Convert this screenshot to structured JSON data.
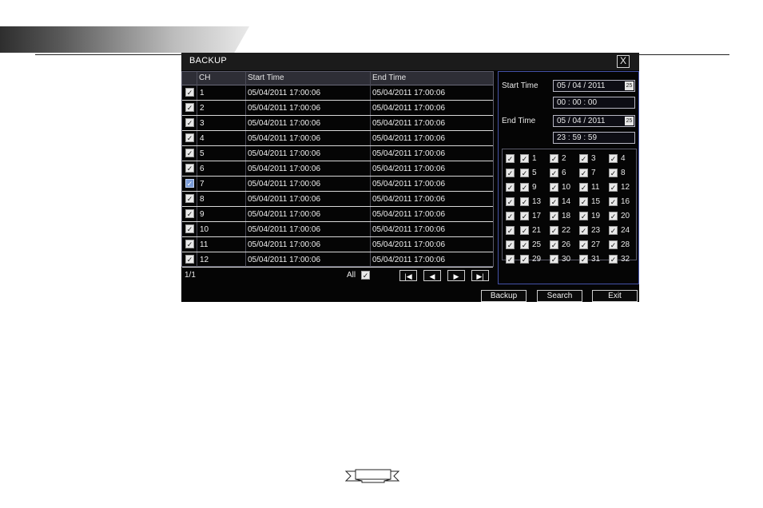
{
  "dialog": {
    "title": "BACKUP",
    "close_glyph": "X"
  },
  "table": {
    "headers": [
      "CH",
      "Start Time",
      "End Time"
    ],
    "rows": [
      {
        "ch": "1",
        "start": "05/04/2011 17:00:06",
        "end": "05/04/2011 17:00:06",
        "checked": true
      },
      {
        "ch": "2",
        "start": "05/04/2011 17:00:06",
        "end": "05/04/2011 17:00:06",
        "checked": true
      },
      {
        "ch": "3",
        "start": "05/04/2011 17:00:06",
        "end": "05/04/2011 17:00:06",
        "checked": true
      },
      {
        "ch": "4",
        "start": "05/04/2011 17:00:06",
        "end": "05/04/2011 17:00:06",
        "checked": true
      },
      {
        "ch": "5",
        "start": "05/04/2011 17:00:06",
        "end": "05/04/2011 17:00:06",
        "checked": true
      },
      {
        "ch": "6",
        "start": "05/04/2011 17:00:06",
        "end": "05/04/2011 17:00:06",
        "checked": true
      },
      {
        "ch": "7",
        "start": "05/04/2011 17:00:06",
        "end": "05/04/2011 17:00:06",
        "checked": true,
        "selected": true
      },
      {
        "ch": "8",
        "start": "05/04/2011 17:00:06",
        "end": "05/04/2011 17:00:06",
        "checked": true
      },
      {
        "ch": "9",
        "start": "05/04/2011 17:00:06",
        "end": "05/04/2011 17:00:06",
        "checked": true
      },
      {
        "ch": "10",
        "start": "05/04/2011 17:00:06",
        "end": "05/04/2011 17:00:06",
        "checked": true
      },
      {
        "ch": "11",
        "start": "05/04/2011 17:00:06",
        "end": "05/04/2011 17:00:06",
        "checked": true
      },
      {
        "ch": "12",
        "start": "05/04/2011 17:00:06",
        "end": "05/04/2011 17:00:06",
        "checked": true
      }
    ]
  },
  "pager": {
    "page": "1/1",
    "all_label": "All",
    "all_checked": true,
    "first_glyph": "|◀",
    "prev_glyph": "◀",
    "next_glyph": "▶",
    "last_glyph": "▶|"
  },
  "filter": {
    "start_label": "Start Time",
    "start_date": "05 / 04 / 2011",
    "start_time": "00 : 00 : 00",
    "end_label": "End Time",
    "end_date": "05 / 04 / 2011",
    "end_time": "23 : 59 : 59",
    "calendar_glyph": "25"
  },
  "channels": [
    "1",
    "2",
    "3",
    "4",
    "5",
    "6",
    "7",
    "8",
    "9",
    "10",
    "11",
    "12",
    "13",
    "14",
    "15",
    "16",
    "17",
    "18",
    "19",
    "20",
    "21",
    "22",
    "23",
    "24",
    "25",
    "26",
    "27",
    "28",
    "29",
    "30",
    "31",
    "32"
  ],
  "buttons": {
    "backup": "Backup",
    "search": "Search",
    "exit": "Exit"
  },
  "check_glyph": "✓",
  "colors": {
    "dialog_bg": "#050505",
    "panel_border": "#4452a8",
    "selected_check": "#7a9bd8"
  }
}
